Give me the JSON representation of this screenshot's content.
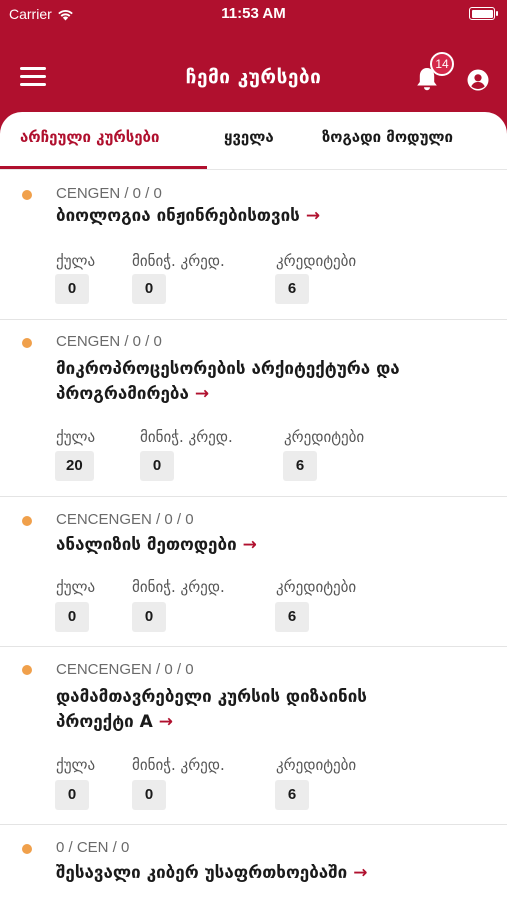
{
  "status_bar": {
    "carrier": "Carrier",
    "time": "11:53 AM"
  },
  "header": {
    "title": "ჩემი კურსები",
    "notification_count": "14"
  },
  "tabs": [
    {
      "label": "არჩეული კურსები",
      "active": true
    },
    {
      "label": "ყველა",
      "active": false
    },
    {
      "label": "ზოგადი მოდული",
      "active": false
    }
  ],
  "courses": [
    {
      "code": "CENGEN / 0 / 0",
      "title": "ბიოლოგია ინჟინრებისთვის",
      "arrow": "→",
      "labels": [
        "ქულა",
        "მინიჭ. კრედ.",
        "კრედიტები"
      ],
      "values": [
        "0",
        "0",
        "6"
      ]
    },
    {
      "code": "CENGEN / 0 / 0",
      "title_lines": [
        "მიკროპროცესორების არქიტექტურა და",
        "პროგრამირება"
      ],
      "arrow": "→",
      "labels": [
        "ქულა",
        "მინიჭ. კრედ.",
        "კრედიტები"
      ],
      "values": [
        "20",
        "0",
        "6"
      ]
    },
    {
      "code": "CENCENGEN / 0 / 0",
      "title": "ანალიზის მეთოდები",
      "arrow": "→",
      "labels": [
        "ქულა",
        "მინიჭ. კრედ.",
        "კრედიტები"
      ],
      "values": [
        "0",
        "0",
        "6"
      ]
    },
    {
      "code": "CENCENGEN / 0 / 0",
      "title_lines": [
        "დამამთავრებელი კურსის დიზაინის",
        "პროექტი A"
      ],
      "arrow": "→",
      "labels": [
        "ქულა",
        "მინიჭ. კრედ.",
        "კრედიტები"
      ],
      "values": [
        "0",
        "0",
        "6"
      ]
    },
    {
      "code": "0 / CEN / 0",
      "title": "შესავალი კიბერ უსაფრთხოებაში",
      "arrow": "→"
    }
  ],
  "icons": {
    "menu": "hamburger-icon",
    "bell": "bell-icon",
    "user": "user-icon",
    "wifi": "wifi-icon",
    "battery": "battery-icon",
    "dot": "status-dot-icon"
  },
  "colors": {
    "brand": "#b0102e",
    "dot": "#f0a04b",
    "box": "#ececec"
  }
}
